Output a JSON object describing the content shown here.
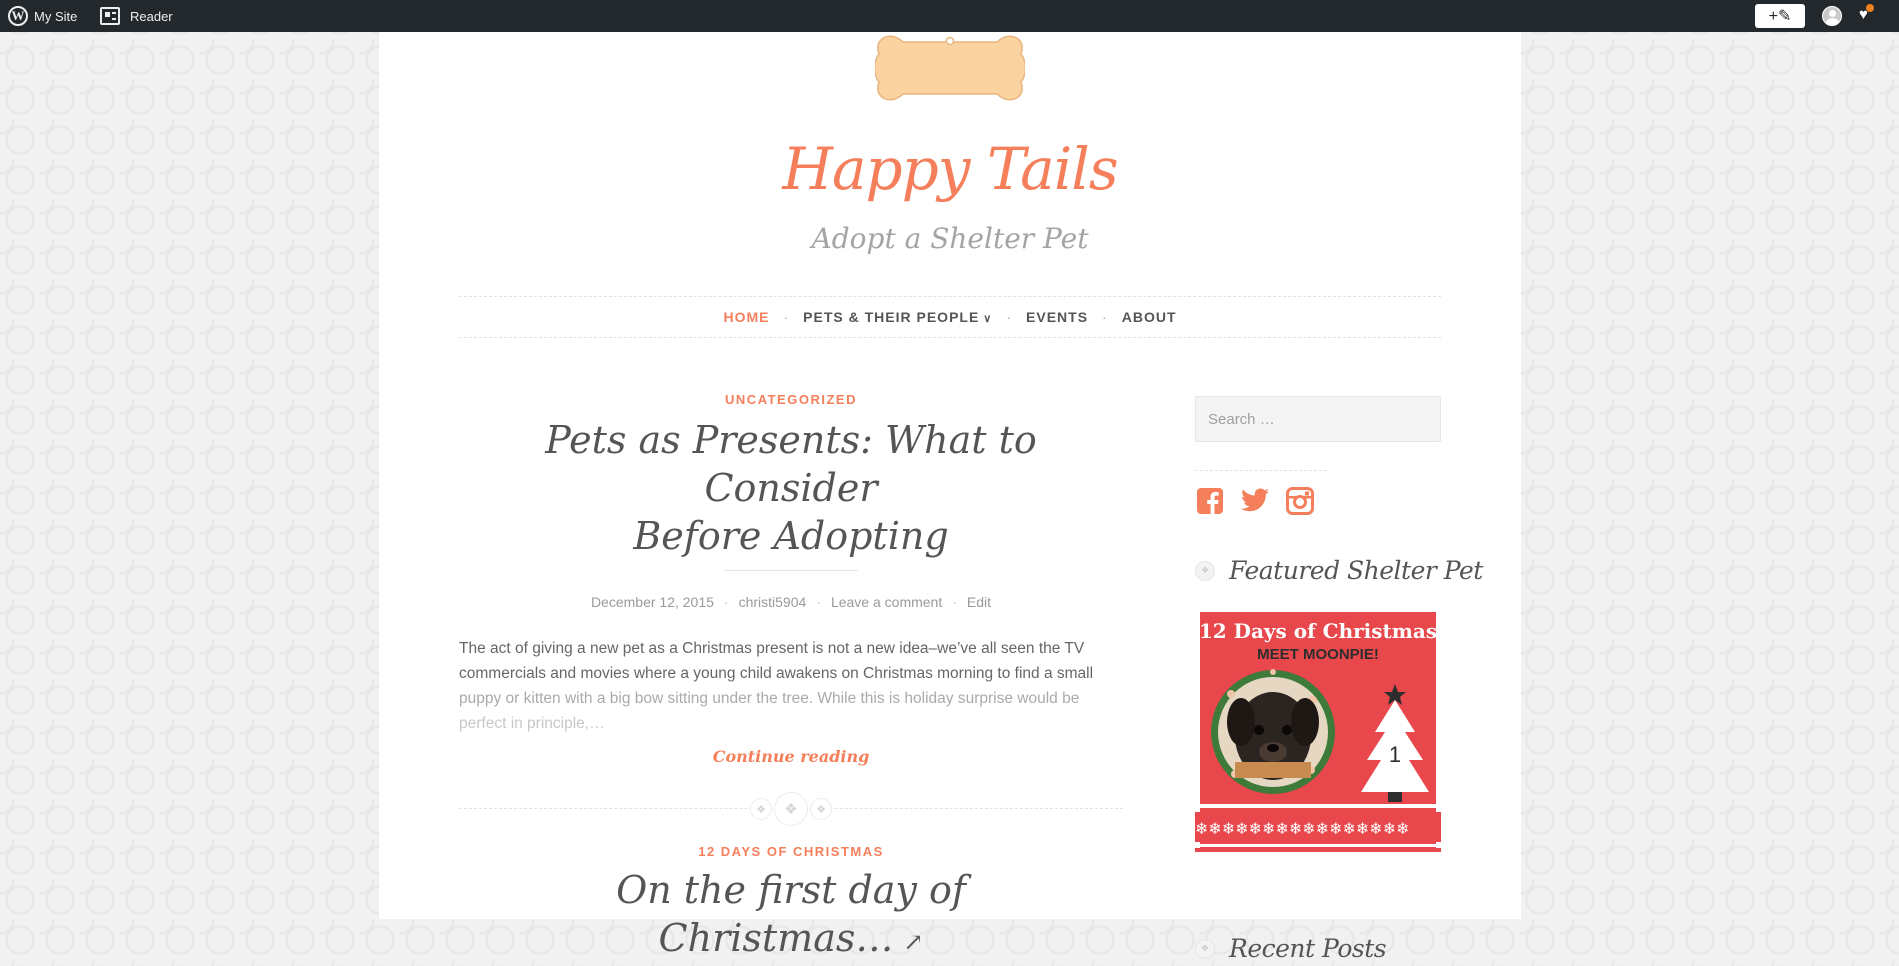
{
  "adminbar": {
    "my_site": "My Site",
    "reader": "Reader",
    "write_icon": "write-pencil-icon",
    "avatar_icon": "avatar-icon",
    "notifications_icon": "notifications-icon"
  },
  "site": {
    "title": "Happy Tails",
    "tagline": "Adopt a Shelter Pet",
    "accent_color": "#f57f5b"
  },
  "nav": {
    "items": [
      {
        "label": "HOME",
        "active": true
      },
      {
        "label": "PETS & THEIR PEOPLE",
        "has_dropdown": true
      },
      {
        "label": "EVENTS"
      },
      {
        "label": "ABOUT"
      }
    ]
  },
  "posts": [
    {
      "category": "UNCATEGORIZED",
      "title_line1": "Pets as Presents: What to Consider",
      "title_line2": "Before Adopting",
      "date": "December 12, 2015",
      "author": "christi5904",
      "comment": "Leave a comment",
      "edit": "Edit",
      "excerpt_1": "The act of giving a new pet as a Christmas present is not a new idea–we’ve all seen the TV",
      "excerpt_2": "commercials and movies where a young child awakens on Christmas morning to find a small",
      "excerpt_3": "puppy or kitten with a big bow sitting under the tree. While this is holiday surprise would be",
      "excerpt_4": "perfect in principle,…",
      "continue": "Continue reading"
    },
    {
      "category": "12 DAYS OF CHRISTMAS",
      "title": "On the first day of Christmas…"
    }
  ],
  "sidebar": {
    "search_placeholder": "Search …",
    "social": [
      "facebook-icon",
      "twitter-icon",
      "instagram-icon"
    ],
    "featured_title": "Featured Shelter Pet",
    "featured_image": {
      "heading": "12 Days of Christmas",
      "subheading": "MEET MOONPIE!",
      "number": "1"
    },
    "next_widget_title": "Recent Posts"
  }
}
